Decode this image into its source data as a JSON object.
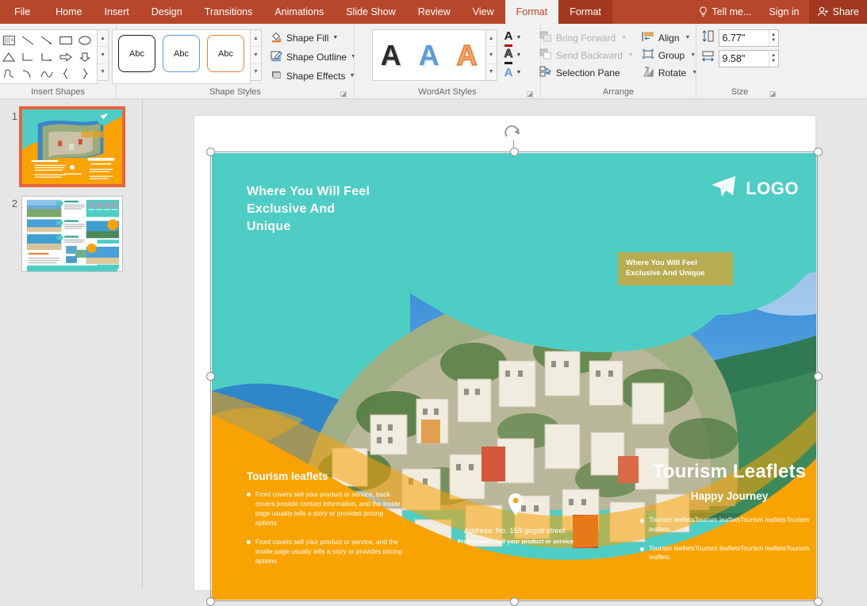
{
  "titlebar": {
    "tabs": [
      {
        "label": "File",
        "state": "file"
      },
      {
        "label": "Home",
        "state": "normal"
      },
      {
        "label": "Insert",
        "state": "normal"
      },
      {
        "label": "Design",
        "state": "normal"
      },
      {
        "label": "Transitions",
        "state": "normal"
      },
      {
        "label": "Animations",
        "state": "normal"
      },
      {
        "label": "Slide Show",
        "state": "normal"
      },
      {
        "label": "Review",
        "state": "normal"
      },
      {
        "label": "View",
        "state": "normal"
      },
      {
        "label": "Format",
        "state": "active"
      },
      {
        "label": "Format",
        "state": "contextual"
      }
    ],
    "tell_me": "Tell me...",
    "sign_in": "Sign in",
    "share": "Share",
    "accent_color": "#b7472a",
    "active_tab_text_color": "#c0462a"
  },
  "ribbon": {
    "groups": [
      {
        "name": "Insert Shapes",
        "shape_rows": [
          [
            "text-box-shape",
            "vertical-text-box-shape",
            "line-shape",
            "arrow-line-shape",
            "rectangle-shape",
            "oval-shape"
          ],
          [
            "rounded-rectangle-shape",
            "triangle-shape",
            "elbow-connector-shape",
            "elbow-arrow-connector-shape",
            "right-arrow-shape",
            "down-arrow-shape"
          ],
          [
            "pie-shape",
            "freeform-scribble-shape",
            "arc-shape",
            "curve-shape",
            "left-brace-shape",
            "right-brace-shape"
          ]
        ],
        "side_buttons": [
          "edit-shape",
          "text-box",
          "merge-shapes"
        ],
        "has_dialog_launcher": false
      },
      {
        "name": "Shape Styles",
        "previews": [
          {
            "label": "Abc",
            "outline": "#1a1a1a"
          },
          {
            "label": "Abc",
            "outline": "#5b9bd5"
          },
          {
            "label": "Abc",
            "outline": "#ed7d31"
          }
        ],
        "commands": [
          {
            "label": "Shape Fill",
            "icon": "paint-bucket-icon",
            "enabled": true
          },
          {
            "label": "Shape Outline",
            "icon": "pen-outline-icon",
            "enabled": true
          },
          {
            "label": "Shape Effects",
            "icon": "shape-effects-icon",
            "enabled": true
          }
        ],
        "has_dialog_launcher": true
      },
      {
        "name": "WordArt Styles",
        "previews": [
          {
            "label": "A",
            "style": "black-shadow"
          },
          {
            "label": "A",
            "style": "blue-shadow"
          },
          {
            "label": "A",
            "style": "orange-outline"
          }
        ],
        "commands": [
          {
            "label": "A",
            "icon": "text-fill-icon",
            "bar_color": "#c00000"
          },
          {
            "label": "A",
            "icon": "text-outline-icon",
            "bar_color": "#1a1a1a"
          },
          {
            "label": "A",
            "icon": "text-effects-icon",
            "bar_color": "#5b9bd5"
          }
        ],
        "has_dialog_launcher": true
      },
      {
        "name": "Arrange",
        "commands": [
          {
            "label": "Bring Forward",
            "icon": "bring-forward-icon",
            "enabled": false,
            "dropdown": true
          },
          {
            "label": "Send Backward",
            "icon": "send-backward-icon",
            "enabled": false,
            "dropdown": true
          },
          {
            "label": "Selection Pane",
            "icon": "selection-pane-icon",
            "enabled": true,
            "dropdown": false
          },
          {
            "label": "Align",
            "icon": "align-icon",
            "enabled": true,
            "dropdown": true
          },
          {
            "label": "Group",
            "icon": "group-icon",
            "enabled": true,
            "dropdown": true
          },
          {
            "label": "Rotate",
            "icon": "rotate-icon",
            "enabled": true,
            "dropdown": true
          }
        ],
        "has_dialog_launcher": false
      },
      {
        "name": "Size",
        "height": {
          "icon": "shape-height-icon",
          "value": "6.77\""
        },
        "width": {
          "icon": "shape-width-icon",
          "value": "9.58\""
        },
        "has_dialog_launcher": true
      }
    ]
  },
  "thumbnails": [
    {
      "number": "1",
      "selected": true
    },
    {
      "number": "2",
      "selected": false
    }
  ],
  "slide": {
    "hero_title": "Where You Will Feel\nExclusive And\nUnique",
    "hero_title_lines": [
      "Where You Will Feel",
      "Exclusive And",
      "Unique"
    ],
    "logo_text": "LOGO",
    "logo_icon": "paper-plane-icon",
    "badge_lines": [
      "Where You Will Feel",
      "Exclusive And Unique"
    ],
    "left_block": {
      "heading": "Tourism leaflets",
      "bullets": [
        "Front covers sell your product or service, back covers provide contact information, and the inside page usually tells a story or provides pricing options.",
        "Front covers sell your product or service, and the inside page usually tells a story or provides pricing options."
      ]
    },
    "address": {
      "icon": "map-pin-icon",
      "line1": "Address:  No. 159 gogoli street.",
      "line2": "Front covers sell your product or service"
    },
    "right_block": {
      "heading": "Tourism Leaflets",
      "subheading": "Happy Journey",
      "bullets": [
        "Tourism leafletsTourism leafletsTourism leafletsTourism leaflets.",
        "Tourism leafletsTourism leafletsTourism leafletsTourism leaflets."
      ]
    },
    "colors": {
      "teal": "#4ecdc4",
      "orange": "#f9a303",
      "sky": "#1e7fd4",
      "white": "#ffffff"
    },
    "selected": true
  }
}
